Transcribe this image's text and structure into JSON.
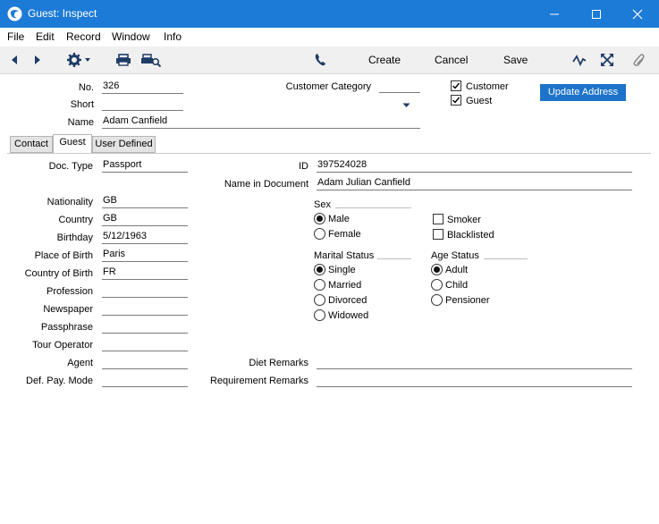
{
  "window": {
    "title": "Guest: Inspect"
  },
  "menu": [
    "File",
    "Edit",
    "Record",
    "Window",
    "Info"
  ],
  "toolbar": {
    "create": "Create",
    "cancel": "Cancel",
    "save": "Save"
  },
  "header": {
    "no_label": "No.",
    "no_value": "326",
    "short_label": "Short",
    "short_value": "",
    "name_label": "Name",
    "name_value": "Adam Canfield",
    "customer_category_label": "Customer Category",
    "customer_category_value": "",
    "customer_label": "Customer",
    "customer_checked": true,
    "guest_label": "Guest",
    "guest_checked": true,
    "update_address": "Update Address"
  },
  "tabs": [
    {
      "label": "Contact",
      "active": false
    },
    {
      "label": "Guest",
      "active": true
    },
    {
      "label": "User Defined",
      "active": false
    }
  ],
  "guest": {
    "doc_type_label": "Doc. Type",
    "doc_type_value": "Passport",
    "id_label": "ID",
    "id_value": "397524028",
    "name_in_doc_label": "Name in Document",
    "name_in_doc_value": "Adam Julian Canfield",
    "nationality_label": "Nationality",
    "nationality_value": "GB",
    "country_label": "Country",
    "country_value": "GB",
    "birthday_label": "Birthday",
    "birthday_value": "5/12/1963",
    "place_of_birth_label": "Place of Birth",
    "place_of_birth_value": "Paris",
    "country_of_birth_label": "Country of Birth",
    "country_of_birth_value": "FR",
    "profession_label": "Profession",
    "profession_value": "",
    "newspaper_label": "Newspaper",
    "newspaper_value": "",
    "passphrase_label": "Passphrase",
    "passphrase_value": "",
    "tour_operator_label": "Tour Operator",
    "tour_operator_value": "",
    "agent_label": "Agent",
    "agent_value": "",
    "def_pay_mode_label": "Def. Pay. Mode",
    "def_pay_mode_value": "",
    "diet_remarks_label": "Diet Remarks",
    "diet_remarks_value": "",
    "requirement_remarks_label": "Requirement Remarks",
    "requirement_remarks_value": "",
    "sex": {
      "label": "Sex",
      "options": [
        "Male",
        "Female"
      ],
      "selected": "Male"
    },
    "smoker_label": "Smoker",
    "smoker_checked": false,
    "blacklisted_label": "Blacklisted",
    "blacklisted_checked": false,
    "marital": {
      "label": "Marital Status",
      "options": [
        "Single",
        "Married",
        "Divorced",
        "Widowed"
      ],
      "selected": "Single"
    },
    "age": {
      "label": "Age Status",
      "options": [
        "Adult",
        "Child",
        "Pensioner"
      ],
      "selected": "Adult"
    }
  }
}
